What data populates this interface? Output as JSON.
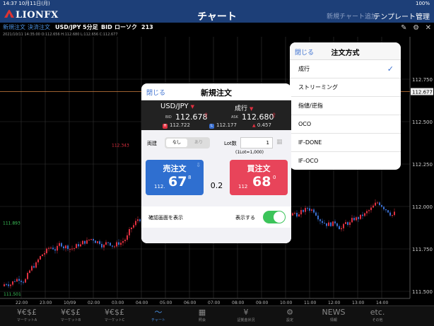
{
  "status_bar": {
    "time_date": "14:37  10月11日(月)",
    "battery": "100%"
  },
  "nav": {
    "logo": "LIONFX",
    "title": "チャート",
    "add_chart": "新規チャート追加",
    "template": "テンプレート管理"
  },
  "toolbar": {
    "new_order": "新規注文",
    "settle_order": "決済注文",
    "pair": "USD/JPY",
    "timeframe": "5分足",
    "side": "BID",
    "candle_type": "ローソク",
    "count": "213",
    "icons": [
      "pencil-icon",
      "gear-icon",
      "close-icon"
    ]
  },
  "info_bar": "2021/10/11 14:35:00   O:112.656  H:112.680  L:112.656  C:112.677",
  "chart": {
    "price_labels": [
      "112.677",
      "112.750",
      "112.500",
      "112.250",
      "112.000",
      "111.750",
      "111.500"
    ],
    "time_labels": [
      "22:00",
      "23:00",
      "10/09",
      "02:00",
      "03:00",
      "04:00",
      "05:00",
      "06:00",
      "07:00",
      "08:00",
      "09:00",
      "10:00",
      "11:00",
      "12:00",
      "13:00",
      "14:00"
    ],
    "high_marker": "112.343",
    "low_marker": "111.501",
    "mid_marker": "111.893",
    "current_marker": "112.677"
  },
  "order_dialog": {
    "close": "閉じる",
    "title": "新規注文",
    "pair": "USD/JPY",
    "order_type": "成行",
    "bid_label": "BID",
    "bid": "112.678",
    "ask_label": "ASK",
    "ask": "112.680",
    "high_badge": "H",
    "high": "112.722",
    "low_badge": "L",
    "low": "112.177",
    "change": "0.457",
    "hedge_label": "両建",
    "hedge_off": "なし",
    "hedge_on": "あり",
    "lot_label": "Lot数",
    "lot_value": "1",
    "lot_note": "(1Lot=1,000)",
    "sell_title": "売注文",
    "sell_prefix": "112.",
    "sell_big": "67",
    "sell_sup": "8",
    "buy_title": "買注文",
    "buy_prefix": "112",
    "buy_big": "68",
    "buy_sup": "0",
    "spread": "0.2",
    "confirm_label": "確認画面を表示",
    "confirm_value": "表示する",
    "confirm_on": true
  },
  "order_type_popover": {
    "close": "閉じる",
    "title": "注文方式",
    "items": [
      "成行",
      "ストリーミング",
      "指値/逆指",
      "OCO",
      "IF-DONE",
      "IF-OCO"
    ],
    "selected_index": 0
  },
  "tab_bar": {
    "tabs": [
      {
        "icon": "¥€$£",
        "label": "マーケットA"
      },
      {
        "icon": "¥€$£",
        "label": "マーケットB"
      },
      {
        "icon": "¥€$£",
        "label": "マーケットC"
      },
      {
        "icon": "〜",
        "label": "チャート"
      },
      {
        "icon": "▦",
        "label": "照会"
      },
      {
        "icon": "¥",
        "label": "証拠金状況"
      },
      {
        "icon": "⚙",
        "label": "設定"
      },
      {
        "icon": "NEWS",
        "label": "情報"
      },
      {
        "icon": "etc.",
        "label": "その他"
      }
    ],
    "active_index": 3
  },
  "colors": {
    "nav_bg": "#1d3f78",
    "up_candle": "#e03040",
    "down_candle": "#3a6fd0",
    "sell": "#2f6fd0",
    "buy": "#e8445a",
    "toggle_on": "#3cc45a",
    "price_line": "#d08040"
  }
}
